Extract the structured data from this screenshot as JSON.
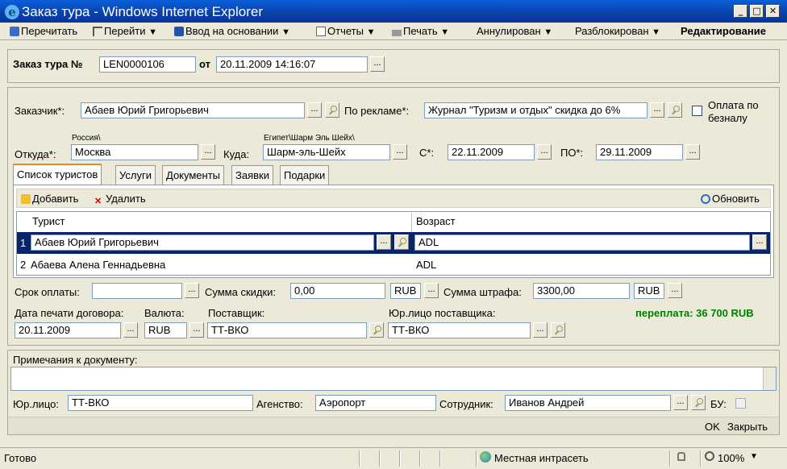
{
  "window": {
    "title": "Заказ тура - Windows Internet Explorer"
  },
  "toolbar": {
    "reread": "Перечитать",
    "goto": "Перейти",
    "goto_arrow": "▼",
    "based_on": "Ввод на основании",
    "based_on_arrow": "▼",
    "reports": "Отчеты",
    "reports_arrow": "▼",
    "print": "Печать",
    "print_arrow": "▼",
    "cancelled": "Аннулирован",
    "cancelled_arrow": "▼",
    "unlocked": "Разблокирован",
    "unlocked_arrow": "▼",
    "editing": "Редактирование"
  },
  "header": {
    "order_label": "Заказ тура №",
    "order_number": "LEN0000106",
    "from_label": "от",
    "date": "20.11.2009 14:16:07",
    "dots": "..."
  },
  "form": {
    "customer_label": "Заказчик*:",
    "customer": "Абаев Юрий Григорьевич",
    "ad_label": "По рекламе*:",
    "ad": "Журнал \"Туризм и отдых\" скидка до 6%",
    "cashless_label_1": "Оплата по",
    "cashless_label_2": "безналу",
    "from_country": "Россия\\",
    "from_label": "Откуда*:",
    "from_city": "Москва",
    "to_country": "Египет\\Шарм Эль Шейх\\",
    "to_label": "Куда:",
    "to_city": "Шарм-эль-Шейх",
    "start_label": "С*:",
    "start_date": "22.11.2009",
    "end_label": "ПО*:",
    "end_date": "29.11.2009"
  },
  "tabs": [
    "Список туристов",
    "Услуги",
    "Документы",
    "Заявки",
    "Подарки"
  ],
  "grid_toolbar": {
    "add": "Добавить",
    "delete": "Удалить",
    "refresh": "Обновить"
  },
  "grid": {
    "columns": [
      "Турист",
      "Возраст"
    ],
    "rows": [
      {
        "n": "1",
        "tourist": "Абаев Юрий Григорьевич",
        "age": "ADL"
      },
      {
        "n": "2",
        "tourist": "Абаева Алена Геннадьевна",
        "age": "ADL"
      }
    ]
  },
  "payment": {
    "term_label": "Срок оплаты:",
    "term": "",
    "discount_label": "Сумма скидки:",
    "discount": "0,00",
    "discount_cur": "RUB",
    "fine_label": "Сумма штрафа:",
    "fine": "3300,00",
    "fine_cur": "RUB",
    "print_date_label": "Дата печати договора:",
    "print_date": "20.11.2009",
    "currency_label": "Валюта:",
    "currency": "RUB",
    "supplier_label": "Поставщик:",
    "supplier": "ТТ-ВКО",
    "supplier_legal_label": "Юр.лицо поставщика:",
    "supplier_legal": "ТТ-ВКО",
    "overpay": "переплата: 36 700 RUB",
    "overpay_color": "#008000"
  },
  "notes": {
    "label": "Примечания к документу:",
    "legal_label": "Юр.лицо:",
    "legal": "ТТ-ВКО",
    "agency_label": "Агенство:",
    "agency": "Аэропорт",
    "employee_label": "Сотрудник:",
    "employee": "Иванов Андрей",
    "bu_label": "БУ:"
  },
  "footer": {
    "ok": "OK",
    "close": "Закрыть"
  },
  "statusbar": {
    "ready": "Готово",
    "zone": "Местная интрасеть",
    "zoom": "100%"
  }
}
